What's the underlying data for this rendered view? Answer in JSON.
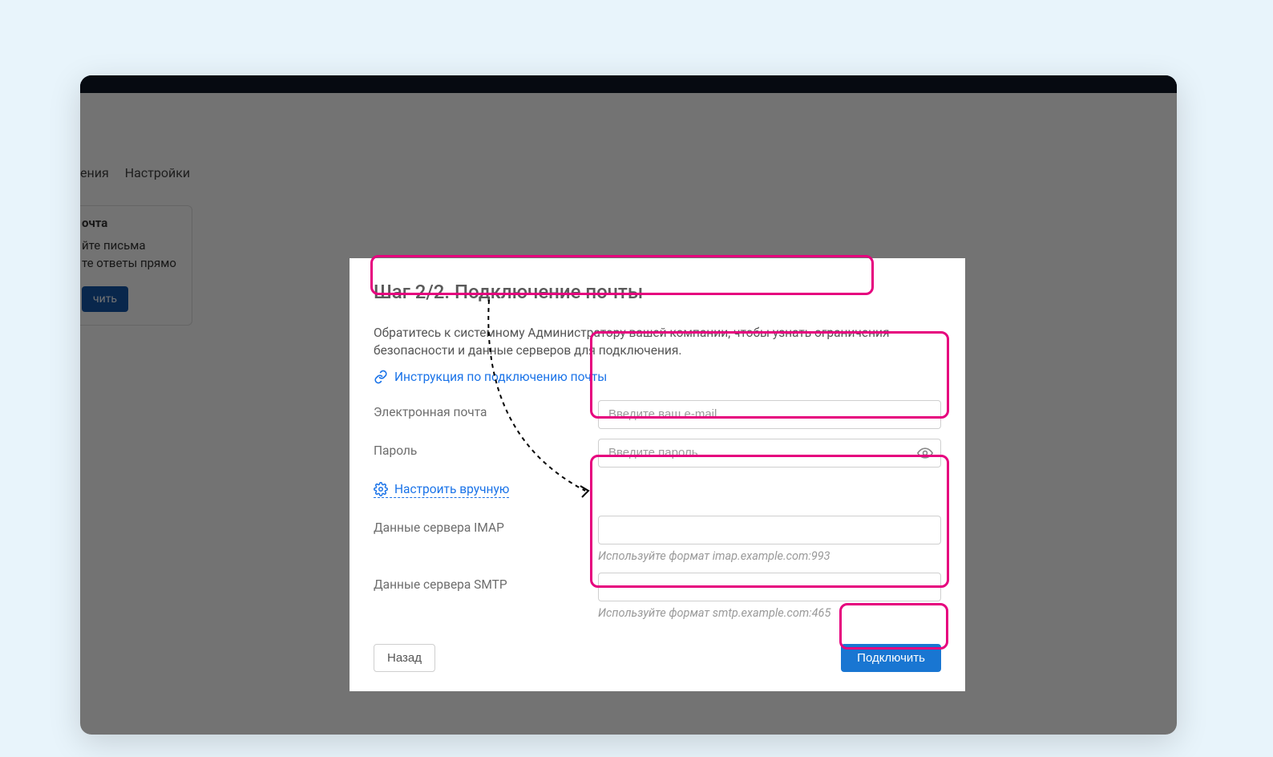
{
  "background": {
    "tabs": {
      "tab1_suffix": "ения",
      "tab2": "Настройки"
    },
    "card": {
      "title_suffix": "очта",
      "line1_suffix": "йте письма",
      "line2_suffix": "те ответы прямо",
      "button_suffix": "чить"
    }
  },
  "modal": {
    "title": "Шаг 2/2. Подключение почты",
    "notice": "Обратитесь к системному Администратору вашей компании, чтобы узнать ограничения безопасности и данные серверов для подключения.",
    "instruction_link": "Инструкция по подключению почты",
    "fields": {
      "email": {
        "label": "Электронная почта",
        "placeholder": "Введите ваш e-mail"
      },
      "password": {
        "label": "Пароль",
        "placeholder": "Введите пароль"
      },
      "manual_link": "Настроить вручную",
      "imap": {
        "label": "Данные сервера IMAP",
        "hint": "Используйте формат imap.example.com:993"
      },
      "smtp": {
        "label": "Данные сервера SMTP",
        "hint": "Используйте формат smtp.example.com:465"
      }
    },
    "buttons": {
      "back": "Назад",
      "connect": "Подключить"
    }
  }
}
